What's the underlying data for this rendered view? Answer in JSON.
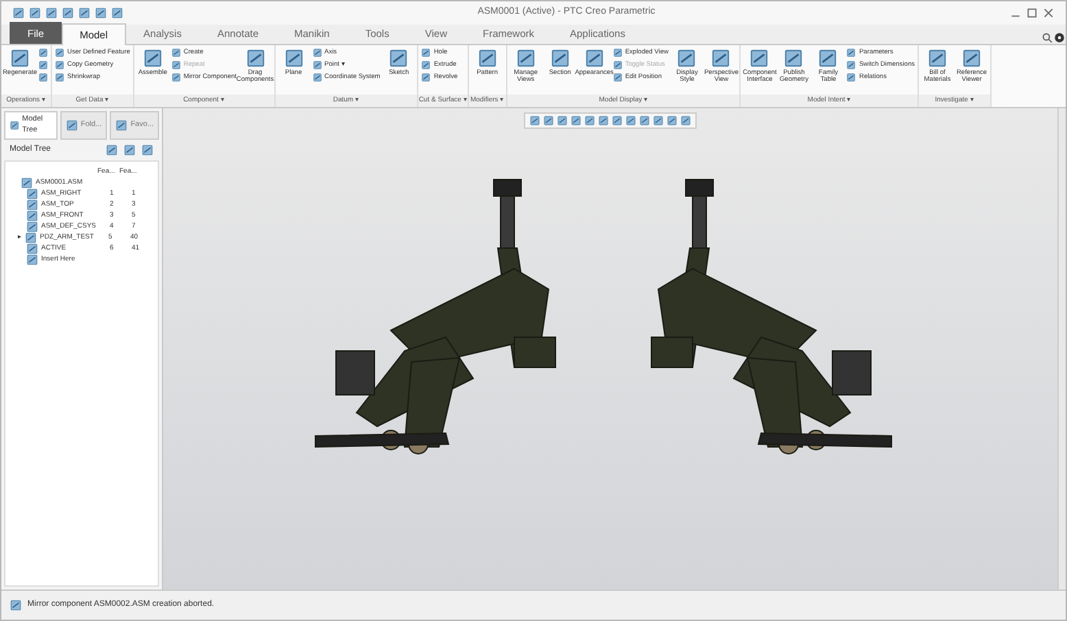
{
  "window": {
    "title": "ASM0001 (Active) - PTC Creo Parametric"
  },
  "tabs": [
    {
      "label": "File",
      "selected": false,
      "kind": "file"
    },
    {
      "label": "Model",
      "selected": true,
      "kind": "tab"
    },
    {
      "label": "Analysis",
      "selected": false,
      "kind": "tab"
    },
    {
      "label": "Annotate",
      "selected": false,
      "kind": "tab"
    },
    {
      "label": "Manikin",
      "selected": false,
      "kind": "tab"
    },
    {
      "label": "Tools",
      "selected": false,
      "kind": "tab"
    },
    {
      "label": "View",
      "selected": false,
      "kind": "tab"
    },
    {
      "label": "Framework",
      "selected": false,
      "kind": "tab"
    },
    {
      "label": "Applications",
      "selected": false,
      "kind": "tab"
    }
  ],
  "ribbon_groups": [
    {
      "label": "Operations ▾",
      "items": [
        {
          "kind": "large",
          "label": "Regenerate"
        },
        {
          "kind": "iconstack"
        }
      ]
    },
    {
      "label": "Get Data ▾",
      "items": [
        {
          "kind": "stack",
          "items": [
            {
              "label": "User Defined Feature",
              "disabled": false
            },
            {
              "label": "Copy Geometry",
              "disabled": false
            },
            {
              "label": "Shrinkwrap",
              "disabled": false
            }
          ]
        }
      ]
    },
    {
      "label": "Component ▾",
      "items": [
        {
          "kind": "large",
          "label": "Assemble"
        },
        {
          "kind": "stack",
          "items": [
            {
              "label": "Create",
              "disabled": false
            },
            {
              "label": "Repeat",
              "disabled": true
            },
            {
              "label": "Mirror Component",
              "disabled": false
            }
          ]
        },
        {
          "kind": "large",
          "label": "Drag Components"
        }
      ]
    },
    {
      "label": "Datum ▾",
      "items": [
        {
          "kind": "large",
          "label": "Plane"
        },
        {
          "kind": "stack",
          "items": [
            {
              "label": "Axis",
              "disabled": false
            },
            {
              "label": "Point ▾",
              "disabled": false
            },
            {
              "label": "Coordinate System",
              "disabled": false
            }
          ]
        },
        {
          "kind": "large",
          "label": "Sketch"
        }
      ]
    },
    {
      "label": "Cut & Surface ▾",
      "items": [
        {
          "kind": "stack",
          "items": [
            {
              "label": "Hole",
              "disabled": false
            },
            {
              "label": "Extrude",
              "disabled": false
            },
            {
              "label": "Revolve",
              "disabled": false
            }
          ]
        }
      ]
    },
    {
      "label": "Modifiers ▾",
      "items": [
        {
          "kind": "large",
          "label": "Pattern"
        }
      ]
    },
    {
      "label": "Model Display ▾",
      "items": [
        {
          "kind": "large",
          "label": "Manage Views"
        },
        {
          "kind": "large",
          "label": "Section"
        },
        {
          "kind": "large",
          "label": "Appearances"
        },
        {
          "kind": "stack",
          "items": [
            {
              "label": "Exploded View",
              "disabled": false
            },
            {
              "label": "Toggle Status",
              "disabled": true
            },
            {
              "label": "Edit Position",
              "disabled": false
            }
          ]
        },
        {
          "kind": "large",
          "label": "Display Style"
        },
        {
          "kind": "large",
          "label": "Perspective View"
        }
      ]
    },
    {
      "label": "Model Intent ▾",
      "items": [
        {
          "kind": "large",
          "label": "Component Interface"
        },
        {
          "kind": "large",
          "label": "Publish Geometry"
        },
        {
          "kind": "large",
          "label": "Family Table"
        },
        {
          "kind": "stack",
          "items": [
            {
              "label": "Parameters",
              "disabled": false
            },
            {
              "label": "Switch Dimensions",
              "disabled": false
            },
            {
              "label": "Relations",
              "disabled": false
            }
          ]
        }
      ]
    },
    {
      "label": "Investigate ▾",
      "items": [
        {
          "kind": "large",
          "label": "Bill of Materials"
        },
        {
          "kind": "large",
          "label": "Reference Viewer"
        }
      ]
    }
  ],
  "navigator": {
    "tabs": [
      {
        "label": "Model Tree",
        "selected": true
      },
      {
        "label": "Fold...",
        "selected": false
      },
      {
        "label": "Favo...",
        "selected": false
      }
    ],
    "title": "Model Tree",
    "columns": [
      "Fea...",
      "Fea..."
    ],
    "rows": [
      {
        "name": "ASM0001.ASM",
        "children": [
          {
            "name": "ASM_RIGHT",
            "cells": [
              "1",
              "1"
            ]
          },
          {
            "name": "ASM_TOP",
            "cells": [
              "2",
              "3"
            ]
          },
          {
            "name": "ASM_FRONT",
            "cells": [
              "3",
              "5"
            ]
          },
          {
            "name": "ASM_DEF_CSYS",
            "cells": [
              "4",
              "7"
            ]
          },
          {
            "name": "PDZ_ARM_TEST",
            "cells": [
              "5",
              "40"
            ],
            "expander": "▸"
          },
          {
            "name": "ACTIVE",
            "cells": [
              "6",
              "41"
            ]
          },
          {
            "name": "Insert Here"
          }
        ]
      }
    ]
  },
  "status_bar": {
    "message": "Mirror component ASM0002.ASM creation aborted."
  }
}
